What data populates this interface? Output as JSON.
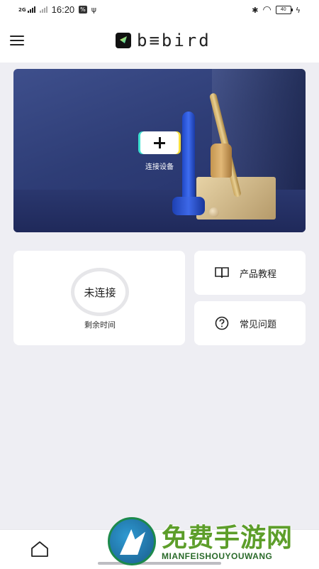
{
  "status_bar": {
    "network": "2G",
    "time": "16:20",
    "hd_badge": "%",
    "usb_symbol": "ψ",
    "bluetooth_symbol": "✱",
    "wifi_symbol": "◠",
    "battery_level": "40",
    "charging_symbol": "ϟ"
  },
  "header": {
    "brand": "b≡bird",
    "menu_icon": "hamburger-icon"
  },
  "banner": {
    "connect_label": "连接设备",
    "button_icon": "plus-icon",
    "accent_colors": [
      "#3de0d0",
      "#f7de3c"
    ]
  },
  "status_card": {
    "connection_state": "未连接",
    "remaining_label": "剩余时间"
  },
  "tiles": [
    {
      "label": "产品教程",
      "icon": "book-icon"
    },
    {
      "label": "常见问题",
      "icon": "question-icon"
    }
  ],
  "bottom_nav": {
    "home_icon": "home-icon"
  },
  "watermark": {
    "title": "免费手游网",
    "subtitle": "MIANFEISHOUYOUWANG"
  }
}
